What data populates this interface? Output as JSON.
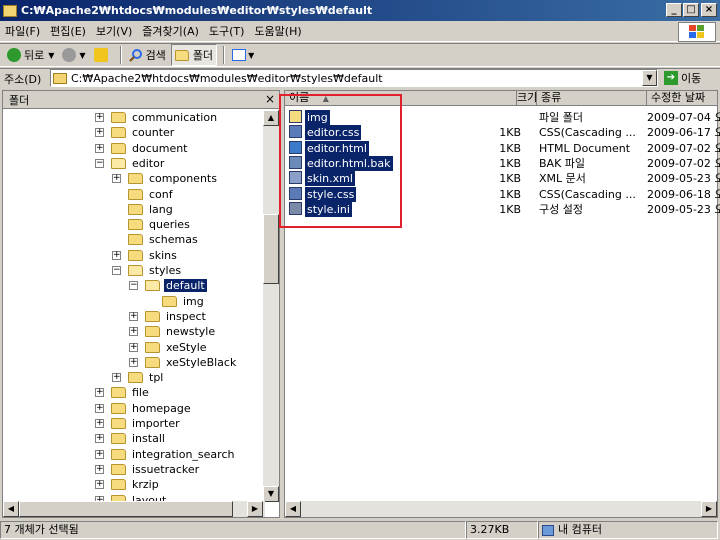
{
  "window": {
    "title": "C:₩Apache2₩htdocs₩modules₩editor₩styles₩default",
    "btn_min": "_",
    "btn_max": "□",
    "btn_close": "×"
  },
  "menu": [
    "파일(F)",
    "편집(E)",
    "보기(V)",
    "즐겨찾기(A)",
    "도구(T)",
    "도움말(H)"
  ],
  "toolbar": {
    "back_label": "뒤로",
    "search_label": "검색",
    "folders_label": "폴더",
    "back_icon": "back-arrow-icon",
    "forward_icon": "forward-arrow-icon",
    "up_icon": "up-folder-icon",
    "search_icon": "search-icon",
    "folders_icon": "folders-icon",
    "views_icon": "views-icon"
  },
  "address": {
    "label": "주소(D)",
    "value": "C:₩Apache2₩htdocs₩modules₩editor₩styles₩default",
    "go_label": "이동"
  },
  "folder_pane": {
    "title": "폴더",
    "close": "×",
    "tree": [
      {
        "label": "communication",
        "depth": 0,
        "exp": "+"
      },
      {
        "label": "counter",
        "depth": 0,
        "exp": "+"
      },
      {
        "label": "document",
        "depth": 0,
        "exp": "+"
      },
      {
        "label": "editor",
        "depth": 0,
        "exp": "-",
        "open": true
      },
      {
        "label": "components",
        "depth": 1,
        "exp": "+"
      },
      {
        "label": "conf",
        "depth": 1,
        "exp": ""
      },
      {
        "label": "lang",
        "depth": 1,
        "exp": ""
      },
      {
        "label": "queries",
        "depth": 1,
        "exp": ""
      },
      {
        "label": "schemas",
        "depth": 1,
        "exp": ""
      },
      {
        "label": "skins",
        "depth": 1,
        "exp": "+"
      },
      {
        "label": "styles",
        "depth": 1,
        "exp": "-",
        "open": true
      },
      {
        "label": "default",
        "depth": 2,
        "exp": "-",
        "open": true,
        "selected": true
      },
      {
        "label": "img",
        "depth": 3,
        "exp": ""
      },
      {
        "label": "inspect",
        "depth": 2,
        "exp": "+"
      },
      {
        "label": "newstyle",
        "depth": 2,
        "exp": "+"
      },
      {
        "label": "xeStyle",
        "depth": 2,
        "exp": "+"
      },
      {
        "label": "xeStyleBlack",
        "depth": 2,
        "exp": "+"
      },
      {
        "label": "tpl",
        "depth": 1,
        "exp": "+"
      },
      {
        "label": "file",
        "depth": 0,
        "exp": "+"
      },
      {
        "label": "homepage",
        "depth": 0,
        "exp": "+"
      },
      {
        "label": "importer",
        "depth": 0,
        "exp": "+"
      },
      {
        "label": "install",
        "depth": 0,
        "exp": "+"
      },
      {
        "label": "integration_search",
        "depth": 0,
        "exp": "+"
      },
      {
        "label": "issuetracker",
        "depth": 0,
        "exp": "+"
      },
      {
        "label": "krzip",
        "depth": 0,
        "exp": "+"
      },
      {
        "label": "layout",
        "depth": 0,
        "exp": "+"
      }
    ]
  },
  "file_list": {
    "columns": [
      "이름",
      "크기",
      "종류",
      "수정한 날짜"
    ],
    "sort_indicator": "▲",
    "rows": [
      {
        "name": "img",
        "size": "",
        "type": "파일 폴더",
        "date": "2009-07-04 오",
        "icon": "folder-icon"
      },
      {
        "name": "editor.css",
        "size": "1KB",
        "type": "CSS(Cascading ...",
        "date": "2009-06-17 오",
        "icon": "css-file-icon"
      },
      {
        "name": "editor.html",
        "size": "1KB",
        "type": "HTML Document",
        "date": "2009-07-02 오",
        "icon": "html-file-icon"
      },
      {
        "name": "editor.html.bak",
        "size": "1KB",
        "type": "BAK 파일",
        "date": "2009-07-02 오",
        "icon": "bak-file-icon"
      },
      {
        "name": "skin.xml",
        "size": "1KB",
        "type": "XML 문서",
        "date": "2009-05-23 오",
        "icon": "xml-file-icon"
      },
      {
        "name": "style.css",
        "size": "1KB",
        "type": "CSS(Cascading ...",
        "date": "2009-06-18 오",
        "icon": "css-file-icon"
      },
      {
        "name": "style.ini",
        "size": "1KB",
        "type": "구성 설정",
        "date": "2009-05-23 오",
        "icon": "ini-file-icon"
      }
    ]
  },
  "status": {
    "selection": "7 개체가 선택됨",
    "size": "3.27KB",
    "location": "내 컴퓨터"
  },
  "colors": {
    "title_bar": "#0a246a",
    "selection": "#0a246a",
    "annotation_box": "#e0202a"
  }
}
